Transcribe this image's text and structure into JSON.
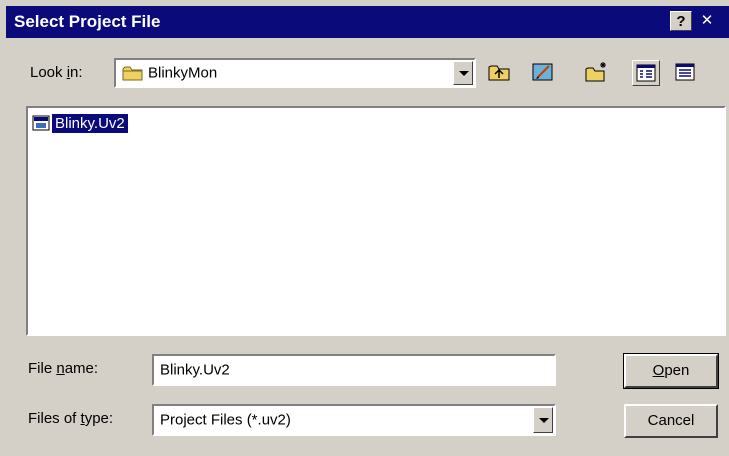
{
  "window": {
    "title": "Select Project File",
    "help_glyph": "?",
    "close_glyph": "✕"
  },
  "look_in": {
    "label_pre": "Look ",
    "label_accel": "i",
    "label_post": "n:",
    "value": "BlinkyMon",
    "icon": "folder-icon"
  },
  "toolbar": {
    "icons": [
      "up-folder-icon",
      "desktop-icon",
      "new-folder-icon",
      "list-view-icon",
      "details-view-icon"
    ]
  },
  "files": [
    {
      "name": "Blinky.Uv2",
      "selected": true,
      "icon": "project-file-icon"
    }
  ],
  "file_name": {
    "label_pre": "File ",
    "label_accel": "n",
    "label_post": "ame:",
    "value": "Blinky.Uv2"
  },
  "file_type": {
    "label_pre": "Files of ",
    "label_accel": "t",
    "label_post": "ype:",
    "value": "Project Files (*.uv2)"
  },
  "buttons": {
    "open_accel": "O",
    "open_rest": "pen",
    "cancel": "Cancel"
  },
  "colors": {
    "titlebar": "#0a0a7a",
    "face": "#d4d0c8",
    "selection": "#0a0a7a"
  }
}
